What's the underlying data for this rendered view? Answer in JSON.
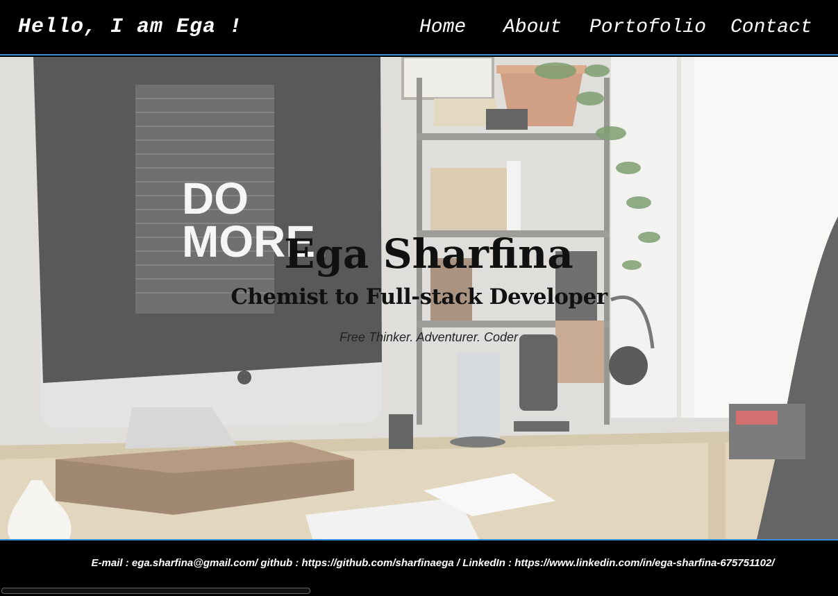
{
  "header": {
    "brand": "Hello, I am Ega !",
    "nav": [
      {
        "label": "Home"
      },
      {
        "label": "About"
      },
      {
        "label": "Portofolio"
      },
      {
        "label": "Contact"
      }
    ]
  },
  "hero": {
    "name": "Ega Sharfina",
    "title": "Chemist to Full-stack Developer",
    "tagline": "Free Thinker. Adventurer. Coder",
    "monitor_text_line1": "DO",
    "monitor_text_line2": "MORE."
  },
  "footer": {
    "contact_line": "E-mail : ega.sharfina@gmail.com/ github : https://github.com/sharfinaega / LinkedIn : https://www.linkedin.com/in/ega-sharfina-675751102/"
  },
  "colors": {
    "header_bg": "#000000",
    "accent_border": "#3a8fd8",
    "nav_text": "#ffffff",
    "hero_text": "#111111"
  }
}
